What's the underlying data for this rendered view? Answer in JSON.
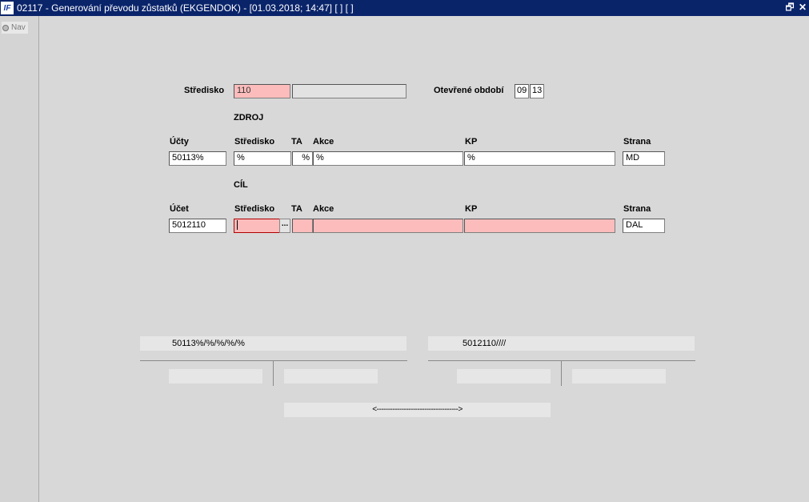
{
  "window": {
    "title": "02117 - Generování převodu zůstatků (EKGENDOK) - [01.03.2018; 14:47]  [ ]  [ ]",
    "logo": "IF",
    "restore_icon": "restore-icon",
    "close_icon": "close-icon"
  },
  "nav": {
    "label": "Nav"
  },
  "header": {
    "stredisko_label": "Středisko",
    "stredisko_value": "110",
    "stredisko_name": "",
    "obdobi_label": "Otevřené období",
    "obdobi_month": "09",
    "obdobi_year": "13"
  },
  "zdroj": {
    "section_label": "ZDROJ",
    "col_ucty": "Účty",
    "col_stredisko": "Středisko",
    "col_ta": "TA",
    "col_akce": "Akce",
    "col_kp": "KP",
    "col_strana": "Strana",
    "ucty": "50113%",
    "stredisko": "%",
    "ta": "%",
    "akce": "%",
    "kp": "%",
    "strana": "MD"
  },
  "cil": {
    "section_label": "CÍL",
    "col_ucet": "Účet",
    "col_stredisko": "Středisko",
    "col_ta": "TA",
    "col_akce": "Akce",
    "col_kp": "KP",
    "col_strana": "Strana",
    "ucet": "5012110",
    "stredisko": "",
    "ta": "",
    "akce": "",
    "kp": "",
    "strana": "DAL",
    "lookup_button": "..."
  },
  "summary": {
    "source_mask": "50113%/%/%/%/%",
    "target_mask": "5012110////",
    "arrow": "<------------------------------------>"
  },
  "colors": {
    "title_bg": "#0a246a",
    "required_field": "#fcbcbc",
    "background": "#d8d8d8"
  }
}
